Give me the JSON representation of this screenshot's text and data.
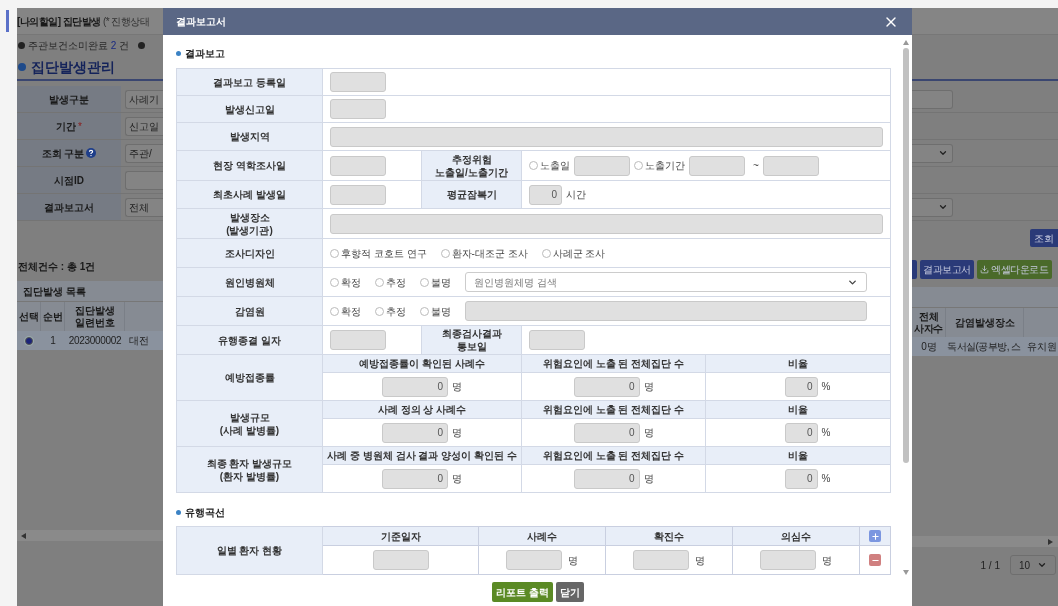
{
  "page": {
    "title": "[나의할일] 집단발생",
    "title_note": "(* 진행상태",
    "notice": {
      "prefix": "주관보건소미완료",
      "count": "2",
      "suffix": "건"
    },
    "heading": "집단발생관리",
    "filters": [
      {
        "label": "발생구분",
        "value": "사례기",
        "kind": "input"
      },
      {
        "label": "기간",
        "mark": "*",
        "value": "신고일",
        "kind": "plain"
      },
      {
        "label": "조회 구분",
        "help": true,
        "value": "주관/",
        "kind": "select"
      },
      {
        "label": "시점ID",
        "kind": "plain"
      },
      {
        "label": "결과보고서",
        "value": "전체",
        "kind": "select"
      }
    ],
    "search_button": "조회",
    "total": "전체건수 : 총 1건",
    "actions": [
      {
        "label": "결과보고서",
        "kind": "primary"
      },
      {
        "label": "엑셀다운로드",
        "kind": "excel"
      }
    ],
    "list": {
      "title": "집단발생 목록",
      "left": {
        "columns": [
          "선택",
          "순번",
          "집단발생\n일련번호"
        ],
        "rows": [
          {
            "selected": true,
            "cells": [
              "",
              "1",
              "2023000002",
              "대전"
            ]
          }
        ]
      },
      "right": {
        "columns": [
          "전체\n사자수",
          "감염발생장소"
        ],
        "rows": [
          {
            "cells": [
              "0명",
              "독서실(공부방, 스",
              "유치원"
            ]
          }
        ]
      }
    },
    "pagination": "1 / 1",
    "page_size": "10"
  },
  "dialog": {
    "title": "결과보고서",
    "report": {
      "title": "결과보고",
      "rows": [
        {
          "kind": "date",
          "label": "결과보고 등록일"
        },
        {
          "kind": "date",
          "label": "발생신고일"
        },
        {
          "kind": "wide",
          "label": "발생지역"
        },
        {
          "kind": "exposure",
          "label": "현장 역학조사일",
          "label2": "추정위험\n노출일/노출기간",
          "options": [
            {
              "label": "노출일",
              "selected": false
            },
            {
              "label": "노출기간",
              "selected": false
            }
          ],
          "separator": "~"
        },
        {
          "kind": "incubation",
          "label": "최초사례 발생일",
          "label2": "평균잠복기",
          "value": "0",
          "unit": "시간"
        },
        {
          "kind": "wide",
          "label": "발생장소\n(발생기관)"
        },
        {
          "kind": "radios",
          "label": "조사디자인",
          "options": [
            {
              "label": "후향적 코호트 연구",
              "selected": false
            },
            {
              "label": "환자-대조군 조사",
              "selected": false
            },
            {
              "label": "사례군 조사",
              "selected": false
            }
          ]
        },
        {
          "kind": "radios_select",
          "label": "원인병원체",
          "options": [
            {
              "label": "확정",
              "selected": false
            },
            {
              "label": "추정",
              "selected": false
            },
            {
              "label": "불명",
              "selected": false
            }
          ],
          "placeholder": "원인병원체명 검색"
        },
        {
          "kind": "radios_field",
          "label": "감염원",
          "options": [
            {
              "label": "확정",
              "selected": false
            },
            {
              "label": "추정",
              "selected": false
            },
            {
              "label": "불명",
              "selected": false
            }
          ]
        },
        {
          "kind": "two_dates",
          "label": "유행종결 일자",
          "label2": "최종검사결과\n통보일"
        },
        {
          "kind": "ratio",
          "label": "예방접종률",
          "cells": [
            {
              "header": "예방접종률이 확인된 사례수",
              "value": "0",
              "unit": "명"
            },
            {
              "header": "위험요인에 노출 된 전체집단 수",
              "value": "0",
              "unit": "명"
            },
            {
              "header": "비율",
              "value": "0",
              "unit": "%"
            }
          ]
        },
        {
          "kind": "ratio",
          "label": "발생규모\n(사례 발병률)",
          "cells": [
            {
              "header": "사례 정의 상 사례수",
              "value": "0",
              "unit": "명"
            },
            {
              "header": "위험요인에 노출 된 전체집단 수",
              "value": "0",
              "unit": "명"
            },
            {
              "header": "비율",
              "value": "0",
              "unit": "%"
            }
          ]
        },
        {
          "kind": "ratio",
          "label": "최종 환자 발생규모\n(환자 발병률)",
          "cells": [
            {
              "header": "사례 중 병원체 검사 결과 양성이 확인된 수",
              "value": "0",
              "unit": "명"
            },
            {
              "header": "위험요인에 노출 된 전체집단 수",
              "value": "0",
              "unit": "명"
            },
            {
              "header": "비율",
              "value": "0",
              "unit": "%"
            }
          ]
        }
      ]
    },
    "curve": {
      "title": "유행곡선",
      "label": "일별 환자 현황",
      "columns": [
        {
          "header": "기준일자"
        },
        {
          "header": "사례수",
          "unit": "명"
        },
        {
          "header": "확진수",
          "unit": "명"
        },
        {
          "header": "의심수",
          "unit": "명"
        }
      ]
    },
    "buttons": [
      {
        "label": "리포트 출력",
        "kind": "print"
      },
      {
        "label": "닫기",
        "kind": "close"
      }
    ]
  }
}
